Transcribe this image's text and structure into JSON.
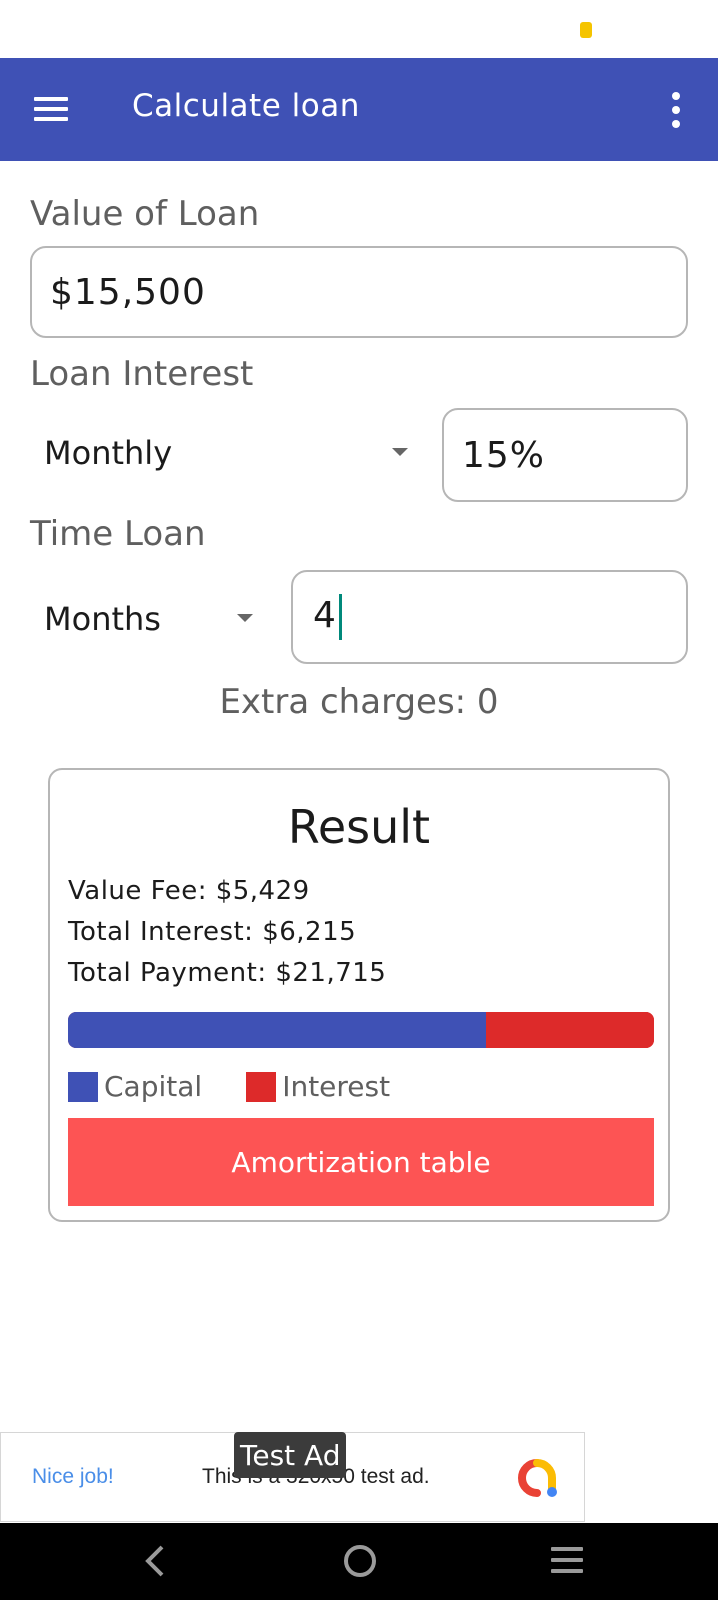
{
  "app_bar": {
    "title": "Calculate loan",
    "menu_icon": "hamburger-menu-icon",
    "overflow_icon": "more-vert-icon",
    "color": "#3f51b5"
  },
  "form": {
    "loan_value": {
      "label": "Value of Loan",
      "value": "$15,500"
    },
    "interest": {
      "label": "Loan Interest",
      "period_selected": "Monthly",
      "rate_value": "15%"
    },
    "time": {
      "label": "Time Loan",
      "unit_selected": "Months",
      "value": "4"
    },
    "extra_charges": "Extra charges: 0"
  },
  "result": {
    "title": "Result",
    "value_fee": "Value Fee: $5,429",
    "total_interest": "Total Interest: $6,215",
    "total_payment": "Total Payment: $21,715",
    "breakdown": {
      "capital_fraction": 0.714,
      "interest_fraction": 0.286,
      "capital_color": "#3f51b5",
      "interest_color": "#dd2a2a"
    },
    "legend": [
      {
        "label": "Capital",
        "color": "#3f51b5"
      },
      {
        "label": "Interest",
        "color": "#dd2a2a"
      }
    ],
    "amortization_button": "Amortization table",
    "button_color": "#fd5454"
  },
  "ad": {
    "label": "Test Ad",
    "headline": "Nice job!",
    "text": "This is a 320x50 test ad.",
    "logo_icon": "ad-network-logo-icon"
  },
  "nav_bar": {
    "back_icon": "back-icon",
    "home_icon": "home-icon",
    "recents_icon": "recents-icon"
  }
}
